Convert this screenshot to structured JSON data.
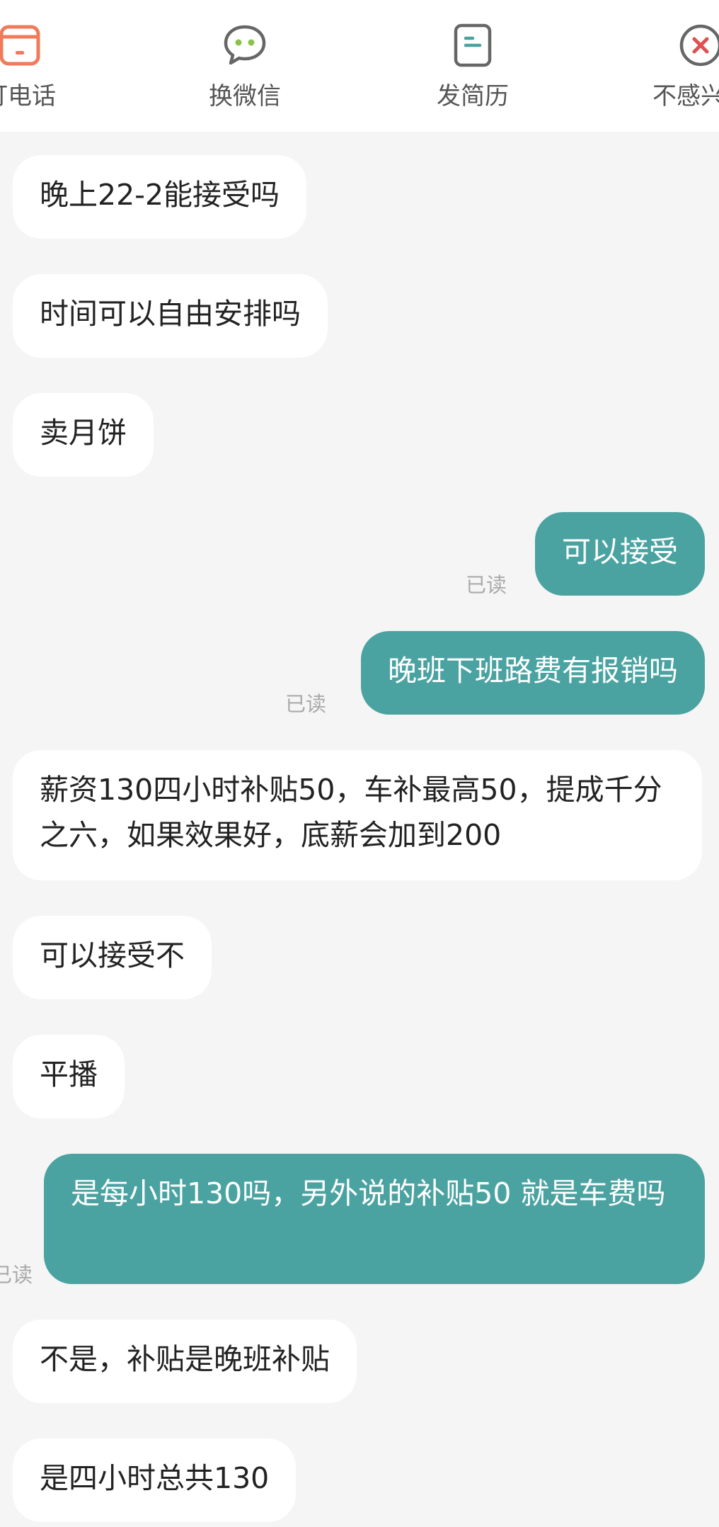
{
  "toolbar": {
    "items": [
      {
        "label": "打电话",
        "icon": "phone-icon",
        "color": "#f07a5a"
      },
      {
        "label": "换微信",
        "icon": "wechat-icon",
        "color": "#8bc34a"
      },
      {
        "label": "发简历",
        "icon": "resume-icon",
        "color": "#4aa3a1"
      },
      {
        "label": "不感兴趣",
        "icon": "close-icon",
        "color": "#e05050"
      }
    ]
  },
  "chat": {
    "read_label": "已读",
    "messages": [
      {
        "side": "in",
        "text": "晚上22-2能接受吗"
      },
      {
        "side": "in",
        "text": "时间可以自由安排吗"
      },
      {
        "side": "in",
        "text": "卖月饼"
      },
      {
        "side": "out",
        "text": "可以接受",
        "read": true
      },
      {
        "side": "out",
        "text": "晚班下班路费有报销吗",
        "read": true
      },
      {
        "side": "in",
        "text": "薪资130四小时补贴50，车补最高50，提成千分之六，如果效果好，底薪会加到200"
      },
      {
        "side": "in",
        "text": "可以接受不"
      },
      {
        "side": "in",
        "text": "平播"
      },
      {
        "side": "out",
        "text": "是每小时130吗，另外说的补贴50 就是车费吗",
        "read": true
      },
      {
        "side": "in",
        "text": "不是，补贴是晚班补贴"
      },
      {
        "side": "in",
        "text": "是四小时总共130"
      }
    ]
  },
  "colors": {
    "outgoing_bubble": "#4aa3a1",
    "incoming_bubble": "#ffffff",
    "background": "#f5f5f5"
  }
}
